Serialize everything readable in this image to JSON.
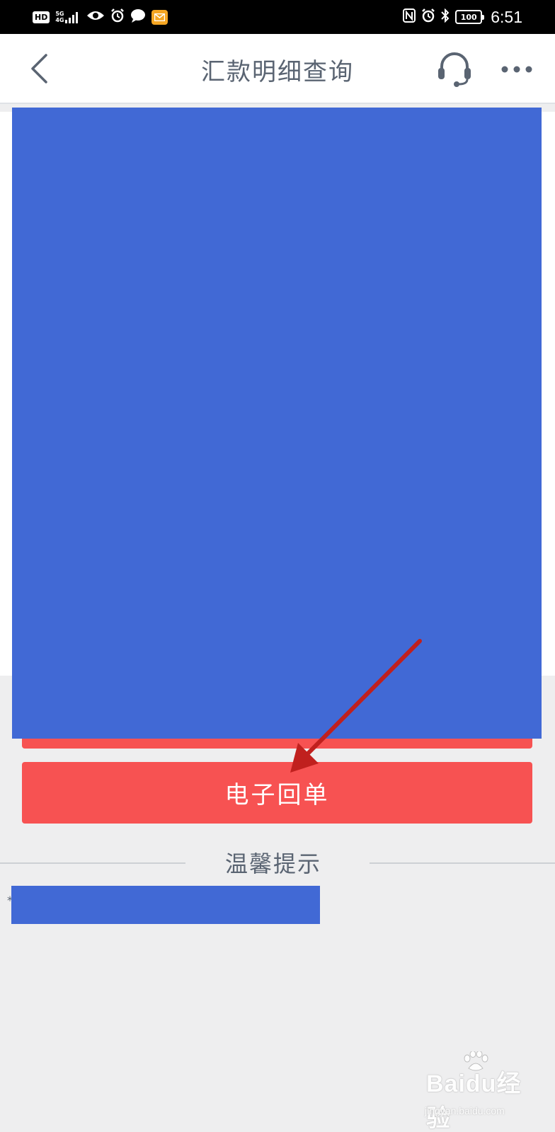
{
  "status_bar": {
    "left_badge": "HD",
    "network": "5G",
    "sub_network": "4G",
    "battery": "100",
    "time": "6:51",
    "icons": [
      "signal-icon",
      "eye-icon",
      "alarm-icon",
      "message-icon",
      "mail-icon",
      "nfc-icon",
      "alarm-icon",
      "bluetooth-icon",
      "battery-icon"
    ]
  },
  "header": {
    "title": "汇款明细查询",
    "back_icon": "chevron-left-icon",
    "service_icon": "headset-icon",
    "more_icon": "more-dots-icon"
  },
  "main": {
    "receipt_button_label": "电子回单",
    "redaction_color": "#4169d5",
    "button_color": "#f75252"
  },
  "tips": {
    "title": "温馨提示",
    "bullet": "*"
  },
  "watermark": {
    "text": "Baidu经验",
    "sub": "jingyan.baidu.com"
  }
}
